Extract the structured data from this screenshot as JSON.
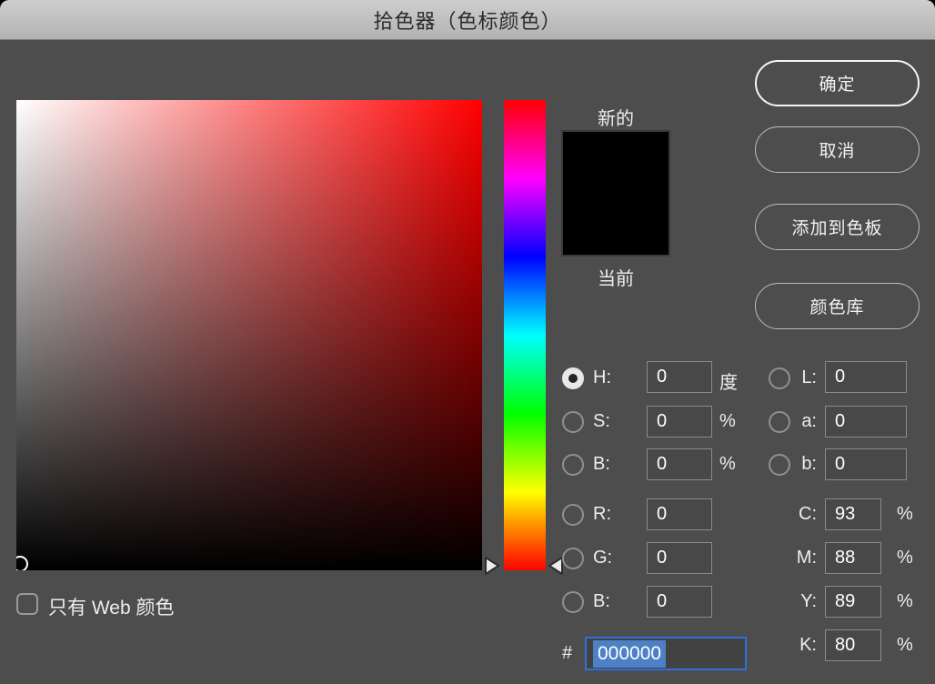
{
  "title": "拾色器（色标颜色）",
  "buttons": {
    "ok": "确定",
    "cancel": "取消",
    "add_to_swatches": "添加到色板",
    "color_libraries": "颜色库"
  },
  "preview": {
    "new_label": "新的",
    "current_label": "当前",
    "new_color": "#000000",
    "current_color": "#000000"
  },
  "fields": {
    "h": {
      "label": "H:",
      "value": "0",
      "unit": "度",
      "selected": true
    },
    "s": {
      "label": "S:",
      "value": "0",
      "unit": "%"
    },
    "b": {
      "label": "B:",
      "value": "0",
      "unit": "%"
    },
    "r": {
      "label": "R:",
      "value": "0"
    },
    "g": {
      "label": "G:",
      "value": "0"
    },
    "b_rgb": {
      "label": "B:",
      "value": "0"
    },
    "l": {
      "label": "L:",
      "value": "0"
    },
    "a": {
      "label": "a:",
      "value": "0"
    },
    "b_lab": {
      "label": "b:",
      "value": "0"
    },
    "c": {
      "label": "C:",
      "value": "93",
      "unit": "%"
    },
    "m": {
      "label": "M:",
      "value": "88",
      "unit": "%"
    },
    "y": {
      "label": "Y:",
      "value": "89",
      "unit": "%"
    },
    "k": {
      "label": "K:",
      "value": "80",
      "unit": "%"
    },
    "hex": {
      "label": "#",
      "value": "000000"
    }
  },
  "checkbox": {
    "label": "只有 Web 颜色",
    "checked": false
  },
  "colors": {
    "dialog_bg": "#4d4d4d",
    "titlebar_top": "#cecece",
    "titlebar_bottom": "#b2b2b2",
    "field_bg": "#484848",
    "field_border": "#8a8a8a",
    "hex_focus_border": "#2e6fe0",
    "hex_selection_bg": "#4d80c4",
    "hue_top": "#ff0000",
    "swatch_color": "#000000"
  }
}
